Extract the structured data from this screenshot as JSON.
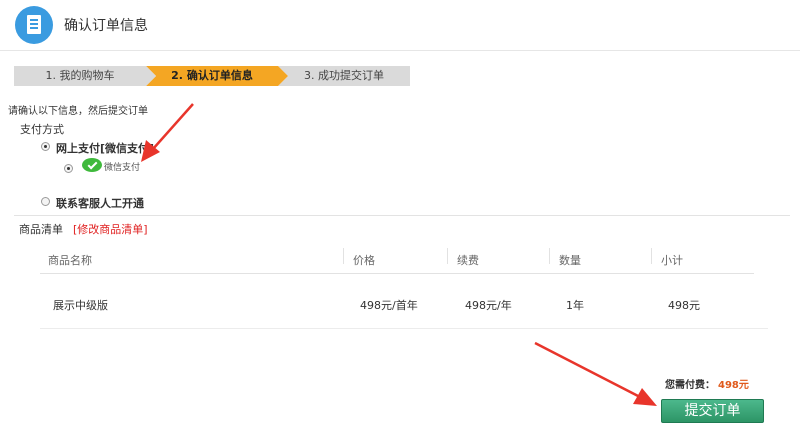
{
  "header": {
    "title": "确认订单信息",
    "icon": "document-icon",
    "icon_color": "#3a9be0"
  },
  "steps": [
    {
      "label": "1. 我的购物车",
      "active": false
    },
    {
      "label": "2. 确认订单信息",
      "active": true
    },
    {
      "label": "3. 成功提交订单",
      "active": false
    }
  ],
  "step_active_color": "#f4a623",
  "notice": "请确认以下信息，然后提交订单",
  "payment": {
    "title": "支付方式",
    "options": [
      {
        "label": "网上支付[微信支付]",
        "selected": true
      },
      {
        "label": "联系客服人工开通",
        "selected": false
      }
    ],
    "sub_option": {
      "label": "微信支付",
      "icon": "wechat-pay-icon",
      "selected": true
    }
  },
  "goods": {
    "title": "商品清单",
    "edit_link": "[修改商品清单]",
    "columns": [
      "商品名称",
      "价格",
      "续费",
      "数量",
      "小计"
    ],
    "rows": [
      {
        "name": "展示中级版",
        "price": "498元/首年",
        "renew": "498元/年",
        "qty": "1年",
        "subtotal": "498元"
      }
    ]
  },
  "summary": {
    "label": "您需付费：",
    "amount": "498元",
    "amount_color": "#e05a1c"
  },
  "submit_label": "提交订单",
  "submit_color": "#2d9566",
  "annotation_color": "#e8352b"
}
